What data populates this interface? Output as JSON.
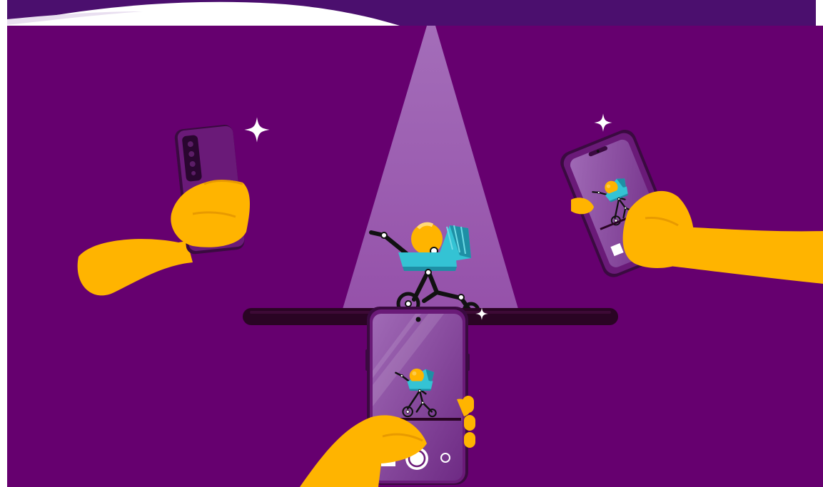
{
  "scene": {
    "description_free": true,
    "colors": {
      "background": "#66006f",
      "top_band": "#4b0f6e",
      "top_wave": "#ffffff",
      "spotlight": "#9a5ab0",
      "shelf": "#2a0424",
      "skin": "#ffb400",
      "skin_shadow": "#e89a00",
      "phone_body": "#6a1a78",
      "phone_edge": "#3a0a40",
      "phone_screen": "#7b3a8e",
      "phone_screen_light": "#9a5ab0",
      "stroller_hood": "#34c3d4",
      "stroller_hood_dark": "#1e8fa5",
      "baby_head": "#ffb400",
      "stroller_frame": "#111111",
      "sparkle": "#ffffff"
    },
    "icons": [
      "sparkle-icon",
      "shutter-icon",
      "flip-camera-icon",
      "gallery-icon"
    ]
  }
}
